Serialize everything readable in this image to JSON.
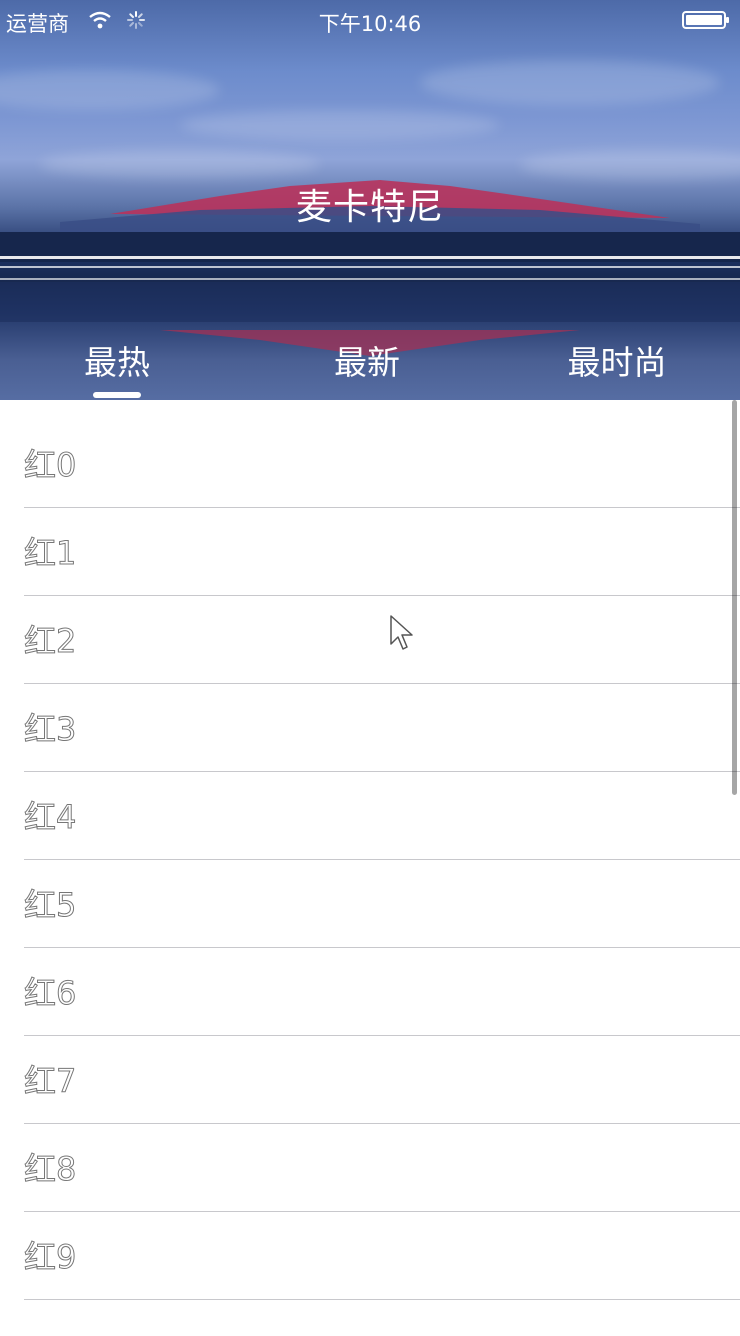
{
  "status_bar": {
    "carrier": "运营商",
    "time": "下午10:46",
    "wifi_icon": "wifi-icon",
    "activity_icon": "spinner-icon",
    "battery_icon": "battery-icon"
  },
  "header": {
    "title": "麦卡特尼",
    "background": "mount-fuji-lake-reflection"
  },
  "tabs": [
    {
      "label": "最热",
      "selected": true
    },
    {
      "label": "最新",
      "selected": false
    },
    {
      "label": "最时尚",
      "selected": false
    }
  ],
  "list": {
    "items": [
      {
        "label": "红0"
      },
      {
        "label": "红1"
      },
      {
        "label": "红2"
      },
      {
        "label": "红3"
      },
      {
        "label": "红4"
      },
      {
        "label": "红5"
      },
      {
        "label": "红6"
      },
      {
        "label": "红7"
      },
      {
        "label": "红8"
      },
      {
        "label": "红9"
      }
    ]
  },
  "colors": {
    "tab_text": "#ffffff",
    "separator": "#c8c8cc",
    "list_background": "#ffffff"
  }
}
